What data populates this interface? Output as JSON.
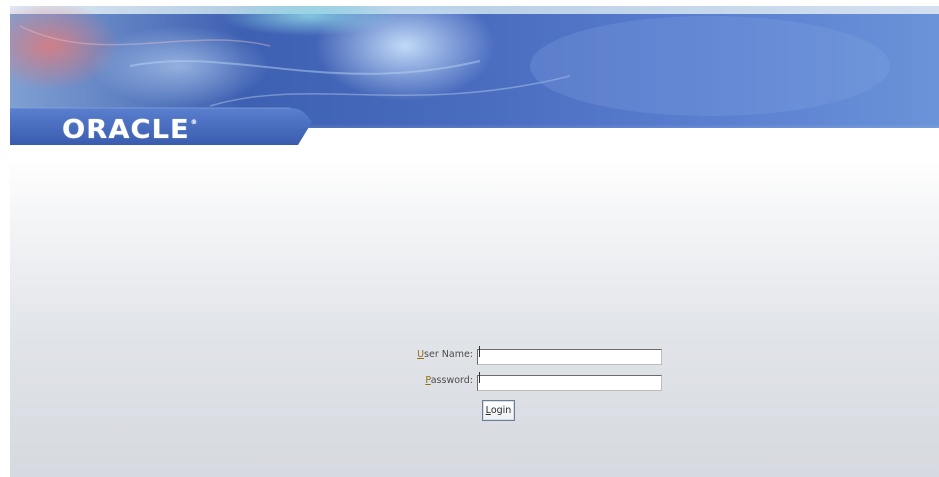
{
  "branding": {
    "logo_text": "ORACLE",
    "logo_mark": "®"
  },
  "login": {
    "username_label_accesskey": "U",
    "username_label_rest": "ser Name:",
    "username_value": "",
    "password_label_accesskey": "P",
    "password_label_rest": "assword:",
    "password_value": "",
    "login_button_accesskey": "L",
    "login_button_rest": "ogin"
  },
  "colors": {
    "banner_blue": "#3f62b5",
    "accesskey_label": "#8f6e1a",
    "page_background_bottom": "#d6d9df"
  },
  "icons": {
    "banner_graphic": "swirl-banner"
  }
}
